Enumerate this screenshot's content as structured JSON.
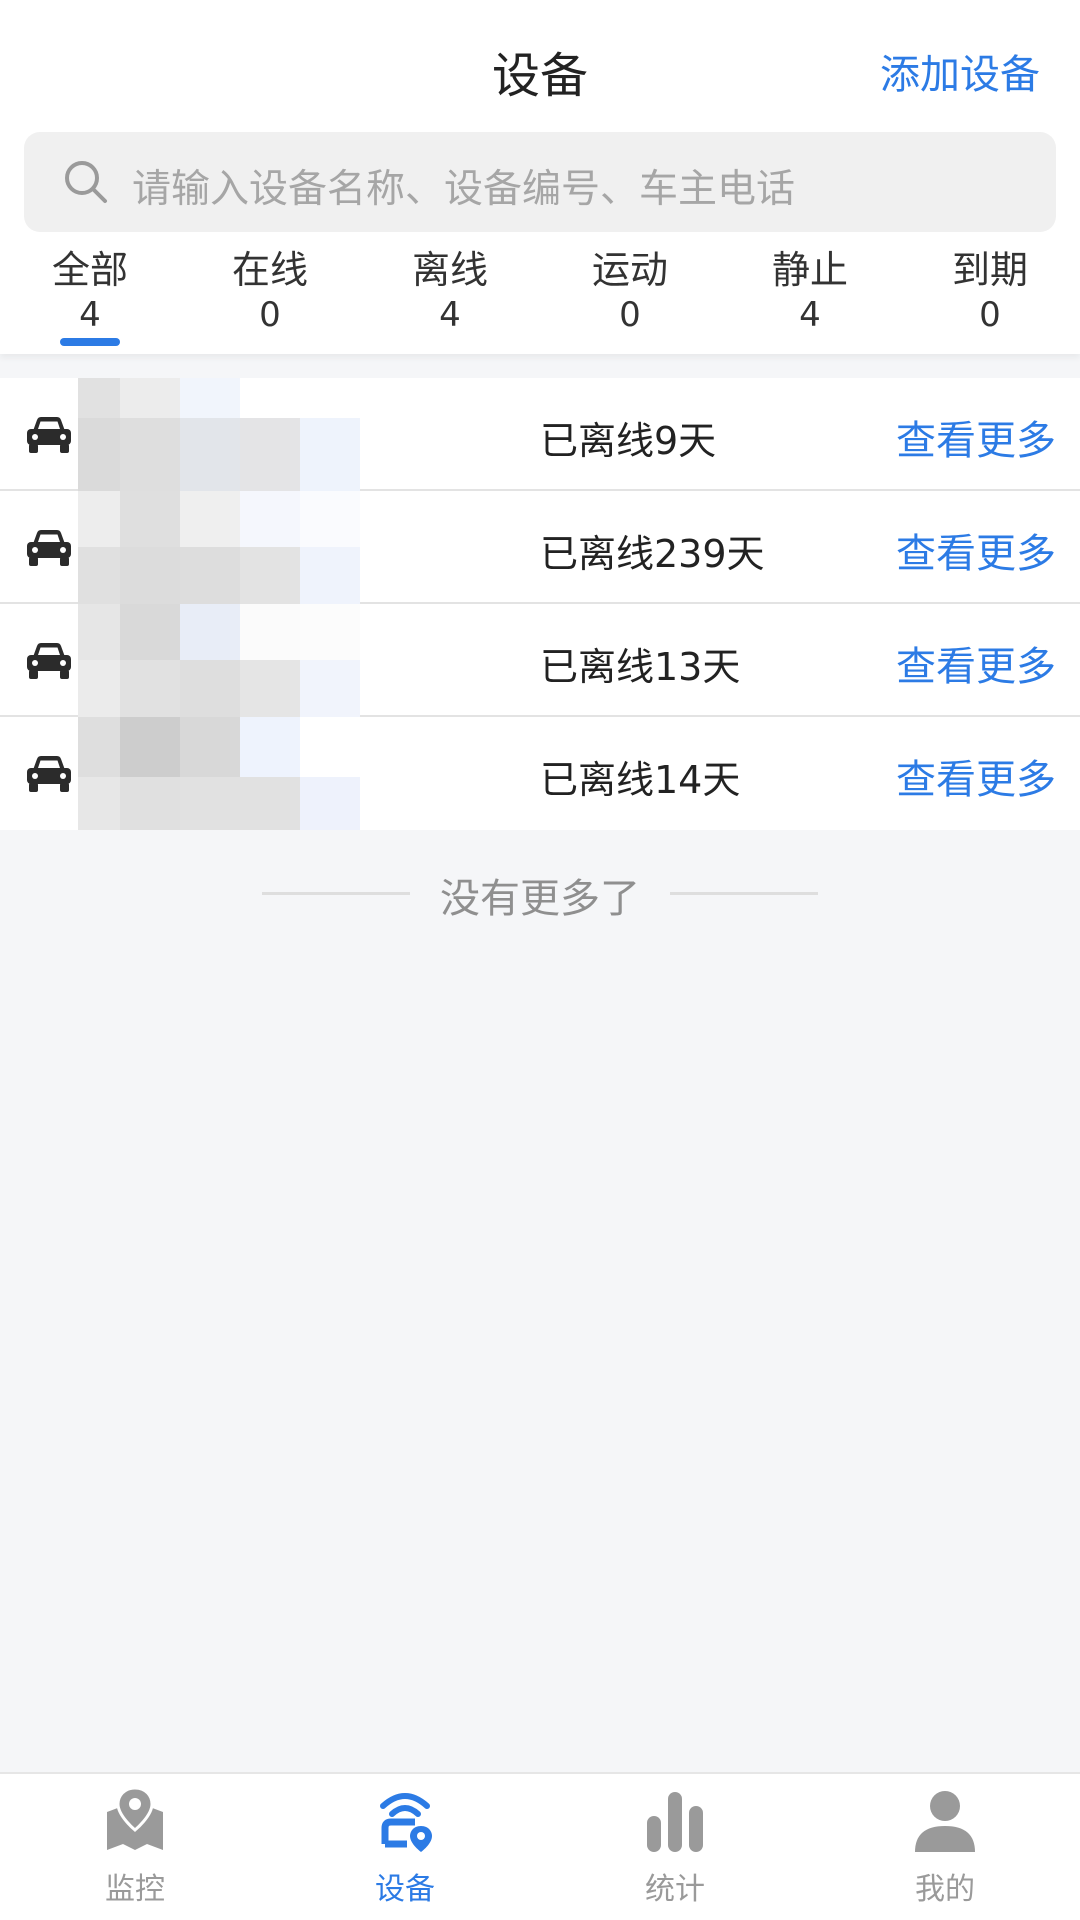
{
  "header": {
    "title": "设备",
    "add_label": "添加设备"
  },
  "search": {
    "placeholder": "请输入设备名称、设备编号、车主电话"
  },
  "tabs": [
    {
      "label": "全部",
      "count": "4",
      "active": true
    },
    {
      "label": "在线",
      "count": "0"
    },
    {
      "label": "离线",
      "count": "4"
    },
    {
      "label": "运动",
      "count": "0"
    },
    {
      "label": "静止",
      "count": "4"
    },
    {
      "label": "到期",
      "count": "0"
    }
  ],
  "devices": [
    {
      "icon": "car-icon",
      "status": "已离线9天",
      "action": "查看更多"
    },
    {
      "icon": "car-icon",
      "status": "已离线239天",
      "action": "查看更多"
    },
    {
      "icon": "car-icon",
      "status": "已离线13天",
      "action": "查看更多"
    },
    {
      "icon": "car-icon",
      "status": "已离线14天",
      "action": "查看更多"
    }
  ],
  "list_end_text": "没有更多了",
  "bottom_nav": [
    {
      "label": "监控",
      "icon": "map-pin-icon"
    },
    {
      "label": "设备",
      "icon": "device-location-icon",
      "active": true
    },
    {
      "label": "统计",
      "icon": "bar-chart-icon"
    },
    {
      "label": "我的",
      "icon": "user-icon"
    }
  ],
  "colors": {
    "accent": "#2c7be5",
    "background": "#f5f6f8"
  }
}
